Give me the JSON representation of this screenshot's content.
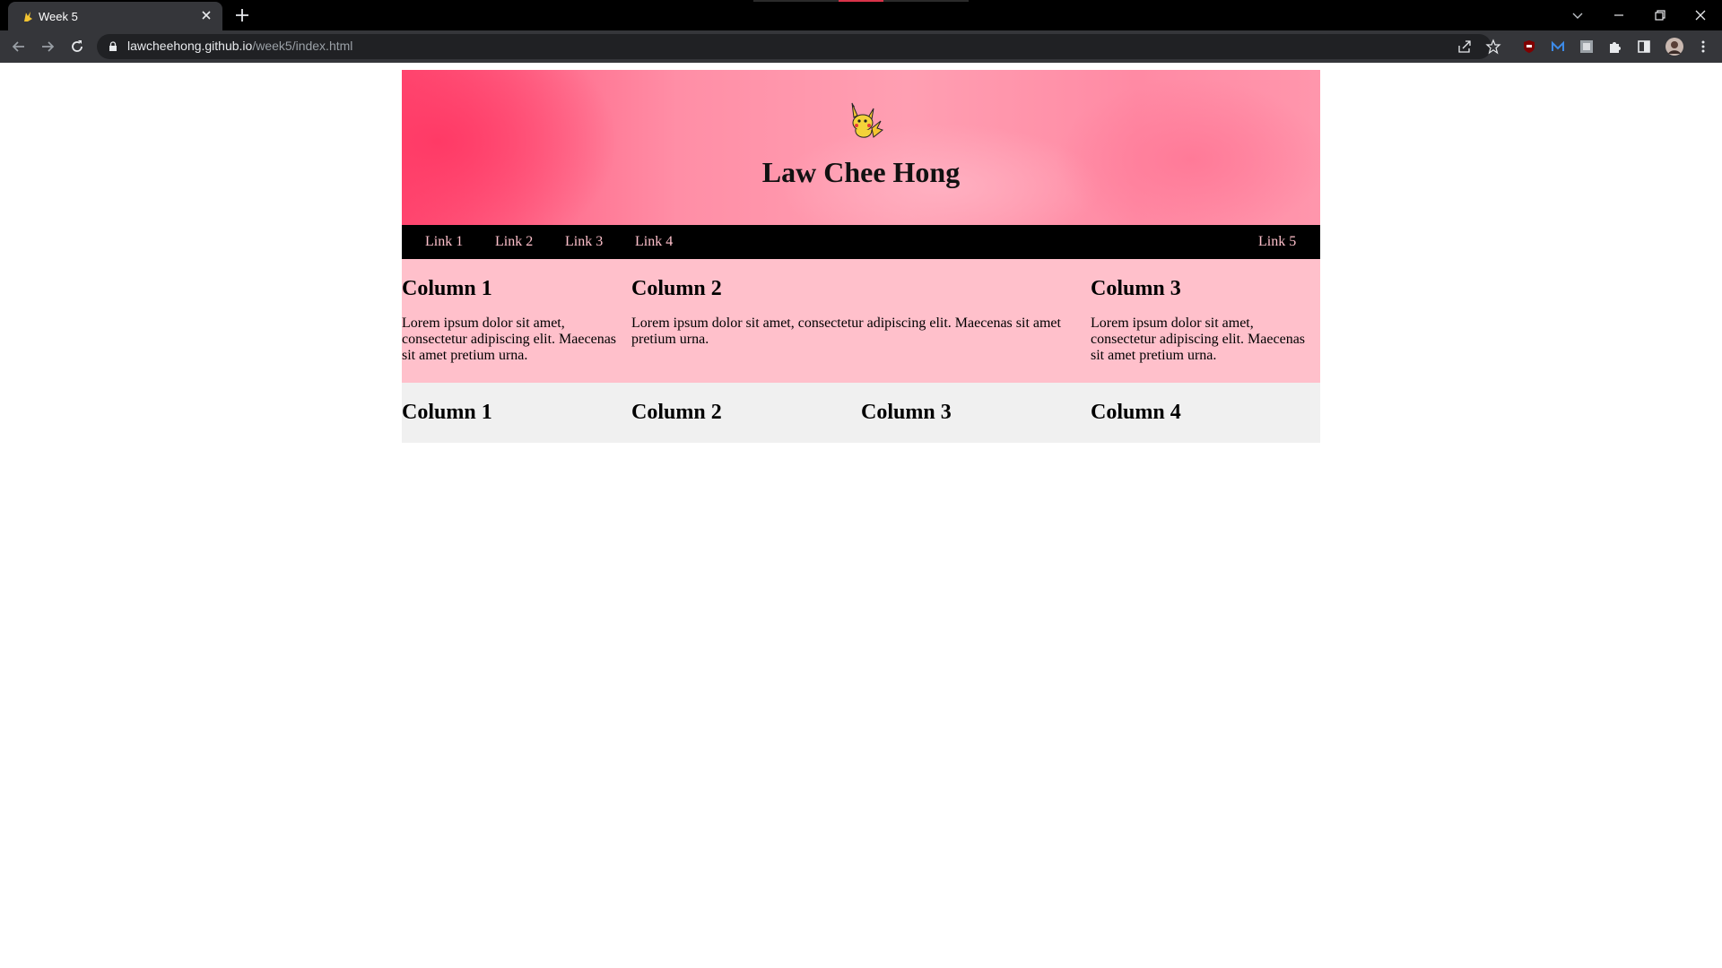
{
  "browser": {
    "tab_title": "Week 5",
    "url_host": "lawcheehong.github.io",
    "url_path": "/week5/index.html"
  },
  "page": {
    "header_title": "Law Chee Hong",
    "nav_links": [
      "Link 1",
      "Link 2",
      "Link 3",
      "Link 4",
      "Link 5"
    ],
    "row1": [
      {
        "heading": "Column 1",
        "text": "Lorem ipsum dolor sit amet, consectetur adipiscing elit. Maecenas sit amet pretium urna."
      },
      {
        "heading": "Column 2",
        "text": "Lorem ipsum dolor sit amet, consectetur adipiscing elit. Maecenas sit amet pretium urna."
      },
      {
        "heading": "Column 3",
        "text": "Lorem ipsum dolor sit amet, consectetur adipiscing elit. Maecenas sit amet pretium urna."
      }
    ],
    "row2": [
      {
        "heading": "Column 1"
      },
      {
        "heading": "Column 2"
      },
      {
        "heading": "Column 3"
      },
      {
        "heading": "Column 4"
      }
    ]
  },
  "colors": {
    "nav_bg": "#000000",
    "nav_link": "#ffc0cb",
    "row1_bg": "#ffc0cb",
    "row2_bg": "#f0f0f0"
  }
}
